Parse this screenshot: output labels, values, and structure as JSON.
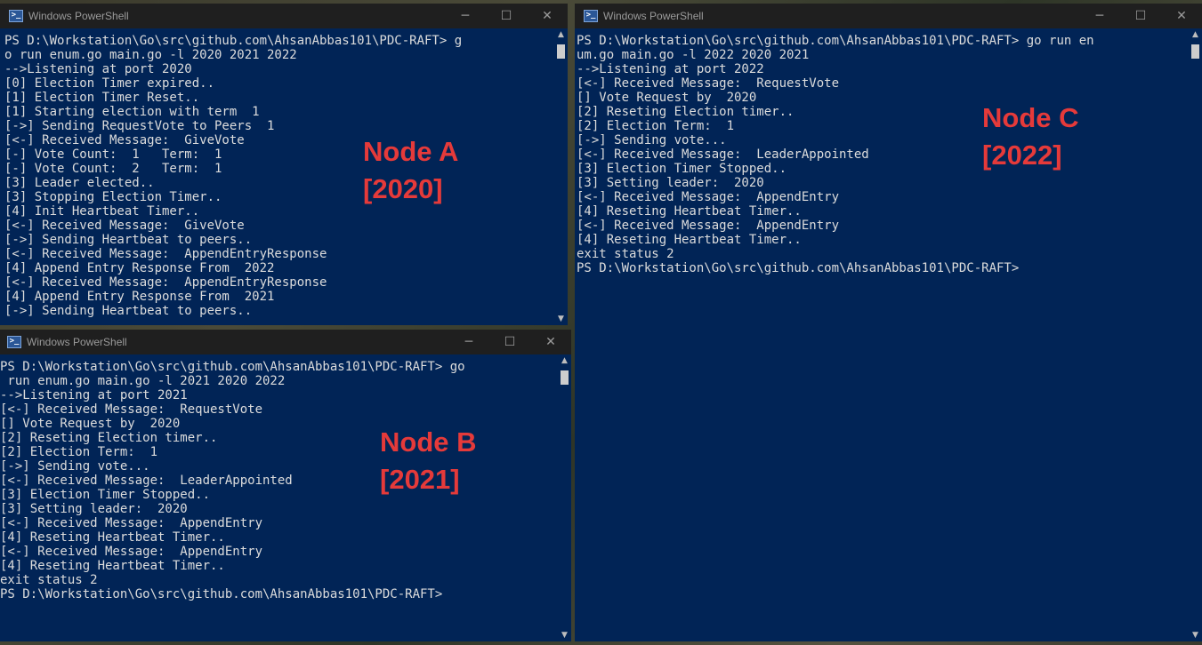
{
  "windows": {
    "a": {
      "title": "Windows PowerShell",
      "controls": {
        "minimize": "─",
        "maximize": "☐",
        "close": "✕"
      },
      "lines": [
        "PS D:\\Workstation\\Go\\src\\github.com\\AhsanAbbas101\\PDC-RAFT> g",
        "o run enum.go main.go -l 2020 2021 2022",
        "-->Listening at port 2020",
        "[0] Election Timer expired..",
        "[1] Election Timer Reset..",
        "[1] Starting election with term  1",
        "[->] Sending RequestVote to Peers  1",
        "[<-] Received Message:  GiveVote",
        "[-] Vote Count:  1   Term:  1",
        "[-] Vote Count:  2   Term:  1",
        "[3] Leader elected..",
        "[3] Stopping Election Timer..",
        "[4] Init Heartbeat Timer..",
        "[<-] Received Message:  GiveVote",
        "[->] Sending Heartbeat to peers..",
        "[<-] Received Message:  AppendEntryResponse",
        "[4] Append Entry Response From  2022",
        "[<-] Received Message:  AppendEntryResponse",
        "[4] Append Entry Response From  2021",
        "[->] Sending Heartbeat to peers.."
      ],
      "label": [
        "Node A",
        "[2020]"
      ]
    },
    "b": {
      "title": "Windows PowerShell",
      "controls": {
        "minimize": "─",
        "maximize": "☐",
        "close": "✕"
      },
      "lines": [
        "PS D:\\Workstation\\Go\\src\\github.com\\AhsanAbbas101\\PDC-RAFT> go",
        " run enum.go main.go -l 2021 2020 2022",
        "-->Listening at port 2021",
        "[<-] Received Message:  RequestVote",
        "[] Vote Request by  2020",
        "[2] Reseting Election timer..",
        "[2] Election Term:  1",
        "[->] Sending vote...",
        "[<-] Received Message:  LeaderAppointed",
        "[3] Election Timer Stopped..",
        "[3] Setting leader:  2020",
        "[<-] Received Message:  AppendEntry",
        "[4] Reseting Heartbeat Timer..",
        "[<-] Received Message:  AppendEntry",
        "[4] Reseting Heartbeat Timer..",
        "exit status 2",
        "PS D:\\Workstation\\Go\\src\\github.com\\AhsanAbbas101\\PDC-RAFT>"
      ],
      "label": [
        "Node B",
        "[2021]"
      ]
    },
    "c": {
      "title": "Windows PowerShell",
      "controls": {
        "minimize": "─",
        "maximize": "☐",
        "close": "✕"
      },
      "lines": [
        "PS D:\\Workstation\\Go\\src\\github.com\\AhsanAbbas101\\PDC-RAFT> go run en",
        "um.go main.go -l 2022 2020 2021",
        "-->Listening at port 2022",
        "[<-] Received Message:  RequestVote",
        "[] Vote Request by  2020",
        "[2] Reseting Election timer..",
        "[2] Election Term:  1",
        "[->] Sending vote...",
        "[<-] Received Message:  LeaderAppointed",
        "[3] Election Timer Stopped..",
        "[3] Setting leader:  2020",
        "[<-] Received Message:  AppendEntry",
        "[4] Reseting Heartbeat Timer..",
        "[<-] Received Message:  AppendEntry",
        "[4] Reseting Heartbeat Timer..",
        "exit status 2",
        "PS D:\\Workstation\\Go\\src\\github.com\\AhsanAbbas101\\PDC-RAFT>"
      ],
      "label": [
        "Node C",
        "[2022]"
      ]
    }
  },
  "colors": {
    "console_bg": "#012456",
    "console_text": "#dcdcdc",
    "label": "#e53a3a",
    "titlebar_active": "#000000",
    "titlebar_inactive": "#1f1f1f"
  }
}
